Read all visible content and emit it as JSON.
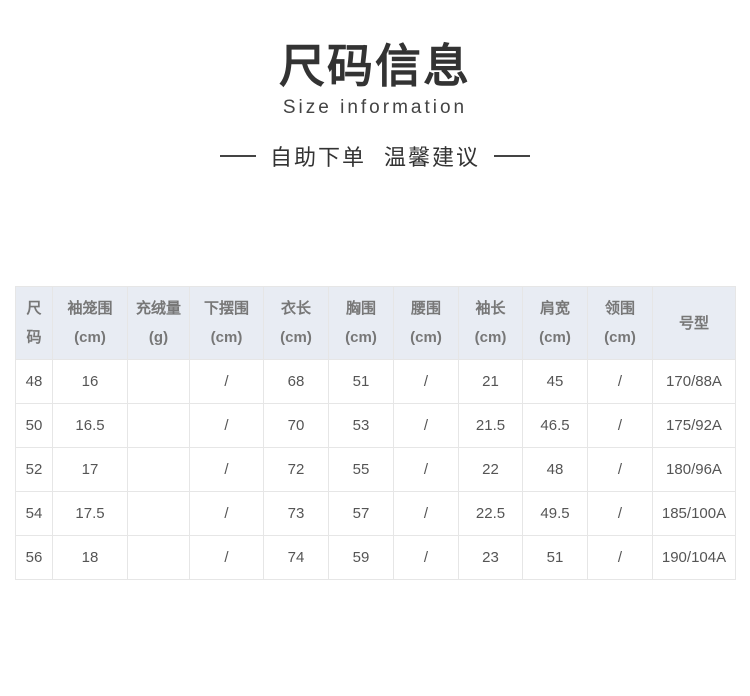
{
  "header": {
    "title_zh": "尺码信息",
    "title_en": "Size information",
    "subtitle": "自助下单  温馨建议"
  },
  "table": {
    "columns": [
      {
        "line1": "尺",
        "line2": "码"
      },
      {
        "line1": "袖笼围",
        "line2": "(cm)"
      },
      {
        "line1": "充绒量",
        "line2": "(g)"
      },
      {
        "line1": "下摆围",
        "line2": "(cm)"
      },
      {
        "line1": "衣长",
        "line2": "(cm)"
      },
      {
        "line1": "胸围",
        "line2": "(cm)"
      },
      {
        "line1": "腰围",
        "line2": "(cm)"
      },
      {
        "line1": "袖长",
        "line2": "(cm)"
      },
      {
        "line1": "肩宽",
        "line2": "(cm)"
      },
      {
        "line1": "领围",
        "line2": "(cm)"
      },
      {
        "line1": "号型",
        "line2": ""
      }
    ],
    "rows": [
      [
        "48",
        "16",
        "",
        "/",
        "68",
        "51",
        "/",
        "21",
        "45",
        "/",
        "170/88A"
      ],
      [
        "50",
        "16.5",
        "",
        "/",
        "70",
        "53",
        "/",
        "21.5",
        "46.5",
        "/",
        "175/92A"
      ],
      [
        "52",
        "17",
        "",
        "/",
        "72",
        "55",
        "/",
        "22",
        "48",
        "/",
        "180/96A"
      ],
      [
        "54",
        "17.5",
        "",
        "/",
        "73",
        "57",
        "/",
        "22.5",
        "49.5",
        "/",
        "185/100A"
      ],
      [
        "56",
        "18",
        "",
        "/",
        "74",
        "59",
        "/",
        "23",
        "51",
        "/",
        "190/104A"
      ]
    ]
  }
}
